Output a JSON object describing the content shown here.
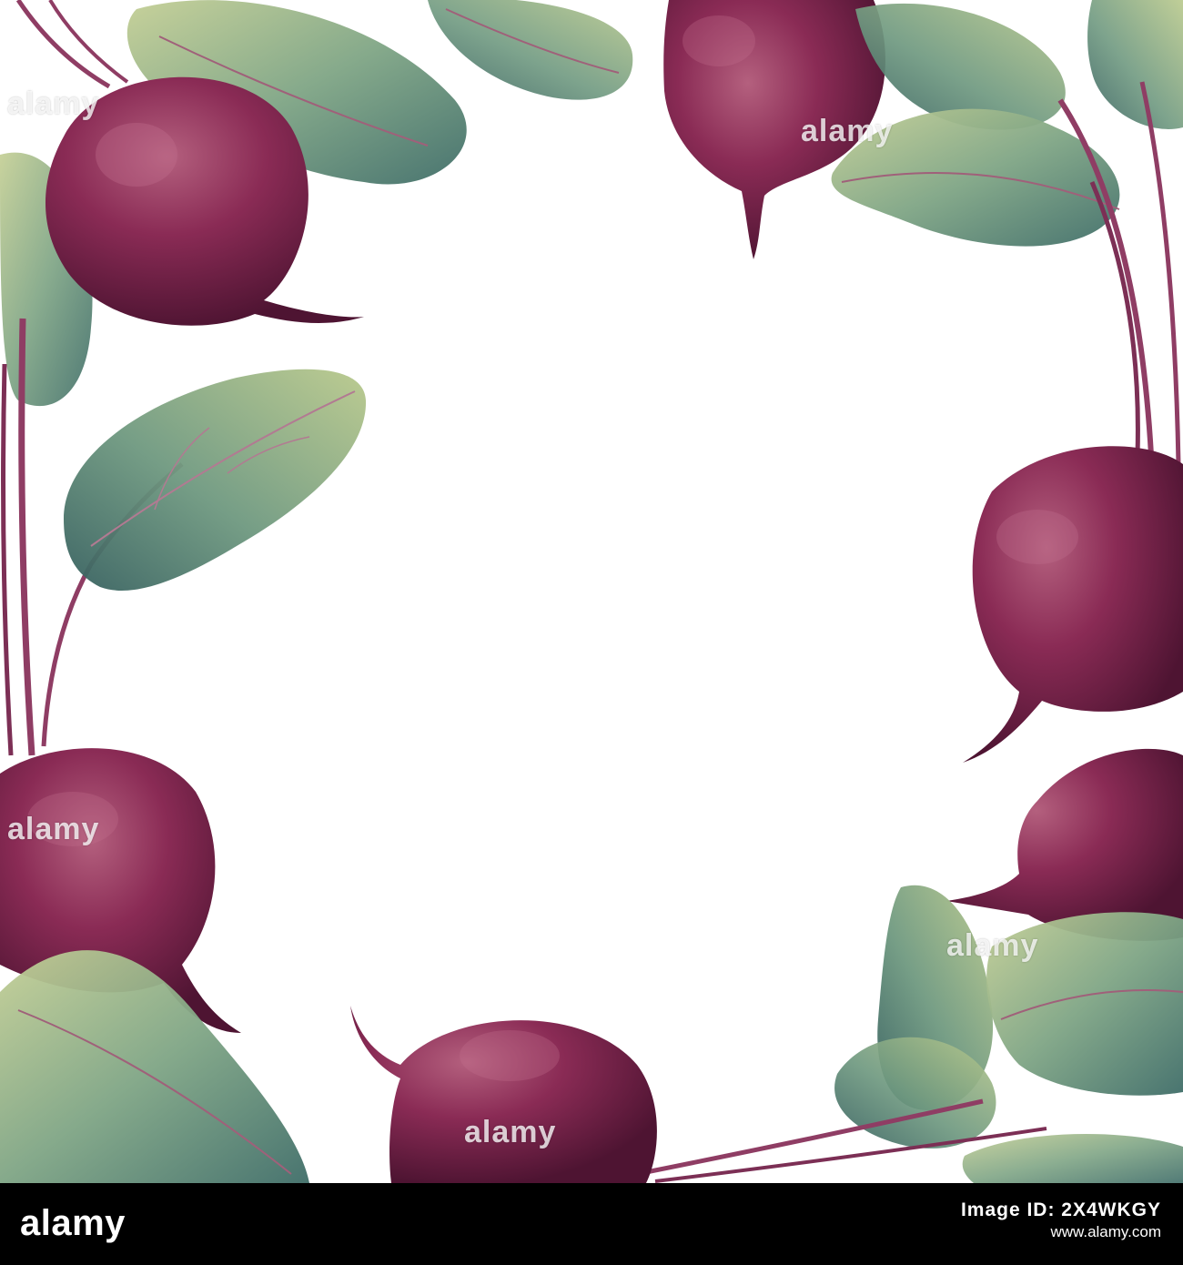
{
  "watermark": {
    "text": "alamy"
  },
  "footer": {
    "logo": "alamy",
    "image_id_label": "Image ID: 2X4WKGY",
    "site": "www.alamy.com"
  },
  "colors": {
    "beet_dark": "#5d1a3c",
    "beet_mid": "#8a2b55",
    "beet_light": "#b4607e",
    "leaf_light": "#c4cf95",
    "leaf_mid": "#7fa585",
    "leaf_dark": "#3f6d68",
    "stem": "#8f3d64",
    "background": "#ffffff",
    "footer_bg": "#000000"
  }
}
